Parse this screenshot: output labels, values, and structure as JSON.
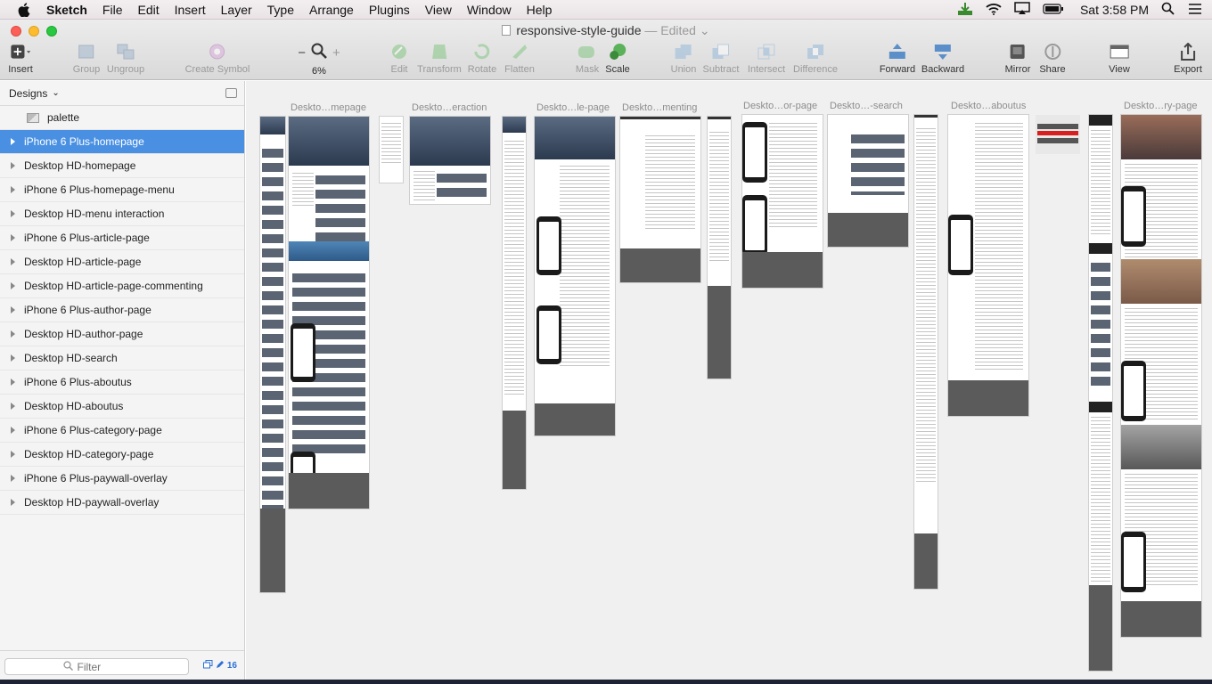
{
  "menubar": {
    "app_name": "Sketch",
    "items": [
      "File",
      "Edit",
      "Insert",
      "Layer",
      "Type",
      "Arrange",
      "Plugins",
      "View",
      "Window",
      "Help"
    ],
    "clock": "Sat 3:58 PM"
  },
  "window": {
    "doc_title": "responsive-style-guide",
    "doc_status": "— Edited"
  },
  "toolbar": {
    "insert": "Insert",
    "group": "Group",
    "ungroup": "Ungroup",
    "create_symbol": "Create Symbol",
    "zoom_level": "6%",
    "edit": "Edit",
    "transform": "Transform",
    "rotate": "Rotate",
    "flatten": "Flatten",
    "mask": "Mask",
    "scale": "Scale",
    "union": "Union",
    "subtract": "Subtract",
    "intersect": "Intersect",
    "difference": "Difference",
    "forward": "Forward",
    "backward": "Backward",
    "mirror": "Mirror",
    "share": "Share",
    "view": "View",
    "export": "Export"
  },
  "sidebar": {
    "pages_label": "Designs",
    "layers": [
      {
        "label": "palette"
      },
      {
        "label": "iPhone 6 Plus-homepage"
      },
      {
        "label": "Desktop HD-homepage"
      },
      {
        "label": "iPhone 6 Plus-homepage-menu"
      },
      {
        "label": "Desktop HD-menu interaction"
      },
      {
        "label": "iPhone 6 Plus-article-page"
      },
      {
        "label": "Desktop HD-article-page"
      },
      {
        "label": "Desktop HD-article-page-commenting"
      },
      {
        "label": "iPhone 6 Plus-author-page"
      },
      {
        "label": "Desktop HD-author-page"
      },
      {
        "label": "Desktop HD-search"
      },
      {
        "label": "iPhone 6 Plus-aboutus"
      },
      {
        "label": "Desktop HD-aboutus"
      },
      {
        "label": "iPhone 6 Plus-category-page"
      },
      {
        "label": "Desktop HD-category-page"
      },
      {
        "label": "iPhone 6 Plus-paywall-overlay"
      },
      {
        "label": "Desktop HD-paywall-overlay"
      }
    ],
    "filter_placeholder": "Filter",
    "artboard_count": "16"
  },
  "canvas": {
    "artboard_labels": [
      "Deskto…mepage",
      "Deskto…eraction",
      "Deskto…le-page",
      "Deskto…menting",
      "Deskto…or-page",
      "Deskto…-search",
      "Deskto…aboutus",
      "Deskto…ry-page"
    ]
  },
  "colors": {
    "selection": "#4a90e2",
    "accent_red": "#d81e1e"
  }
}
